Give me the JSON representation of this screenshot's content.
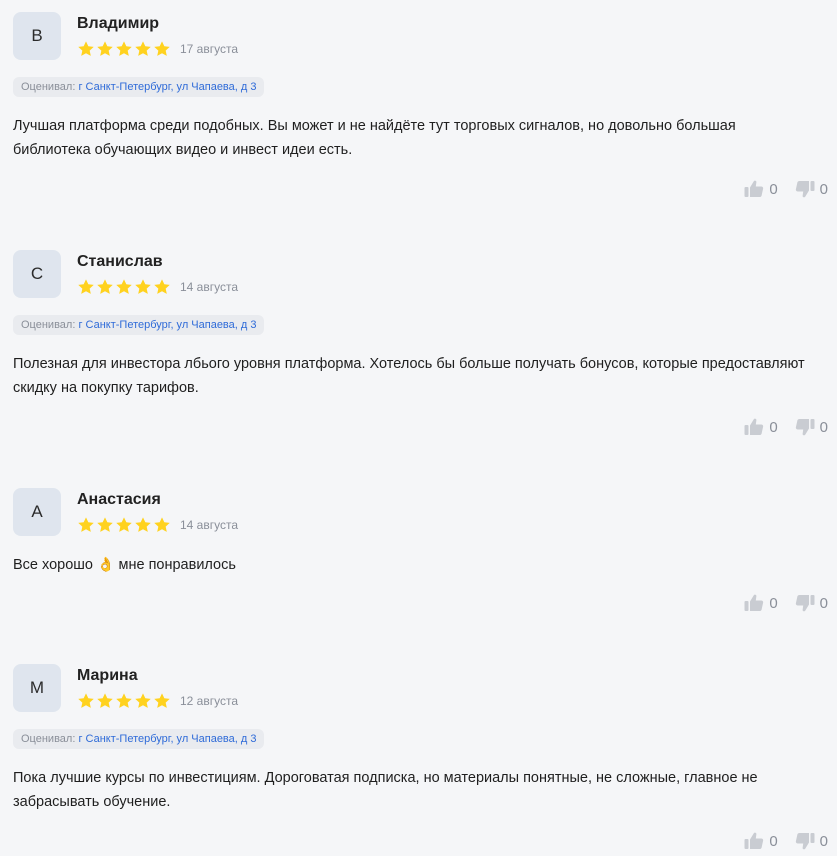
{
  "reviews": [
    {
      "initial": "В",
      "name": "Владимир",
      "rating": 5,
      "date": "17 августа",
      "badge_label": "Оценивал:",
      "badge_address": "г Санкт-Петербург, ул Чапаева, д 3",
      "text": "Лучшая платформа среди подобных. Вы может и не найдёте тут торговых сигналов, но довольно большая библиотека обучающих видео и инвест идеи есть.",
      "likes": "0",
      "dislikes": "0"
    },
    {
      "initial": "С",
      "name": "Станислав",
      "rating": 5,
      "date": "14 августа",
      "badge_label": "Оценивал:",
      "badge_address": "г Санкт-Петербург, ул Чапаева, д 3",
      "text": "Полезная для инвестора лбього уровня платформа. Хотелось бы больше получать бонусов, которые предоставляют скидку на покупку тарифов.",
      "likes": "0",
      "dislikes": "0"
    },
    {
      "initial": "А",
      "name": "Анастасия",
      "rating": 5,
      "date": "14 августа",
      "text_before": "Все хорошо",
      "text_emoji": "👌",
      "text_after": "мне понравилось",
      "likes": "0",
      "dislikes": "0"
    },
    {
      "initial": "М",
      "name": "Марина",
      "rating": 5,
      "date": "12 августа",
      "badge_label": "Оценивал:",
      "badge_address": "г Санкт-Петербург, ул Чапаева, д 3",
      "text": "Пока лучшие курсы по инвестициям. Дороговатая подписка, но материалы понятные, не сложные, главное не забрасывать обучение.",
      "likes": "0",
      "dislikes": "0"
    }
  ],
  "colors": {
    "star": "#ffd21f",
    "thumb": "#c9ccd2",
    "address": "#2f6bd8"
  },
  "icons": {
    "star": "star-icon",
    "like": "thumbs-up-icon",
    "dislike": "thumbs-down-icon"
  }
}
